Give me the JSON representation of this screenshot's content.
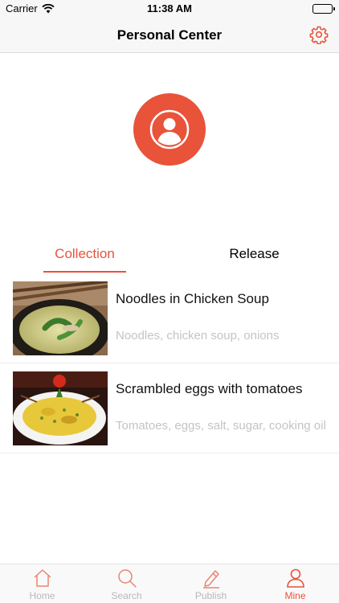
{
  "status_bar": {
    "carrier": "Carrier",
    "time": "11:38 AM"
  },
  "nav": {
    "title": "Personal Center",
    "settings_icon": "gear-icon"
  },
  "profile": {
    "avatar_icon": "user-icon"
  },
  "tabs": [
    {
      "label": "Collection",
      "active": true
    },
    {
      "label": "Release",
      "active": false
    }
  ],
  "items": [
    {
      "name": "Noodles in Chicken Soup",
      "ingredients": "Noodles, chicken soup, onions"
    },
    {
      "name": "Scrambled eggs with tomatoes",
      "ingredients": "Tomatoes, eggs, salt, sugar, cooking oil"
    }
  ],
  "tab_bar": [
    {
      "label": "Home",
      "icon": "home-icon",
      "active": false
    },
    {
      "label": "Search",
      "icon": "search-icon",
      "active": false
    },
    {
      "label": "Publish",
      "icon": "pencil-icon",
      "active": false
    },
    {
      "label": "Mine",
      "icon": "user-icon",
      "active": true
    }
  ],
  "colors": {
    "accent": "#e8533a",
    "inactive": "#b8b8b8"
  }
}
